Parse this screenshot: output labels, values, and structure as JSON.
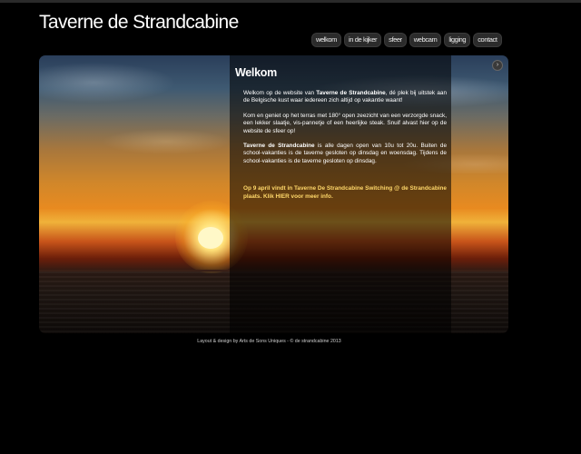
{
  "site_title": "Taverne de Strandcabine",
  "nav": [
    {
      "label": "welkom"
    },
    {
      "label": "in de kijker"
    },
    {
      "label": "sfeer"
    },
    {
      "label": "webcam"
    },
    {
      "label": "ligging"
    },
    {
      "label": "contact"
    }
  ],
  "hero": {
    "next_icon": "chevron-right-icon",
    "next_glyph": "›"
  },
  "panel": {
    "title": "Welkom",
    "p1": {
      "a": "Welkom op de website van ",
      "b": "Taverne de Strandcabine",
      "c": ", dé plek bij uitstek aan de Belgische kust waar iedereen zich altijd op vakantie waant!"
    },
    "p2": "Kom en geniet op het terras met 180° open zeezicht van een verzorgde snack, een lekker slaatje, vis-pannetje of een heerlijke steak. Snuif alvast hier op de website de sfeer op!",
    "p3": {
      "a": "Taverne de Strandcabine",
      "b": " is alle dagen open van 10u tot 20u. Buiten de school-vakanties is de taverne gesloten op dinsdag en woensdag. Tijdens de school-vakanties is de taverne gesloten op dinsdag."
    },
    "notice": "Op 9 april vindt in Taverne De Strandcabine Switching @ de Strandcabine plaats. Klik HIER voor meer info."
  },
  "footer": "Layout & design by Arts de Sons Uniques - © de strandcabine 2013"
}
